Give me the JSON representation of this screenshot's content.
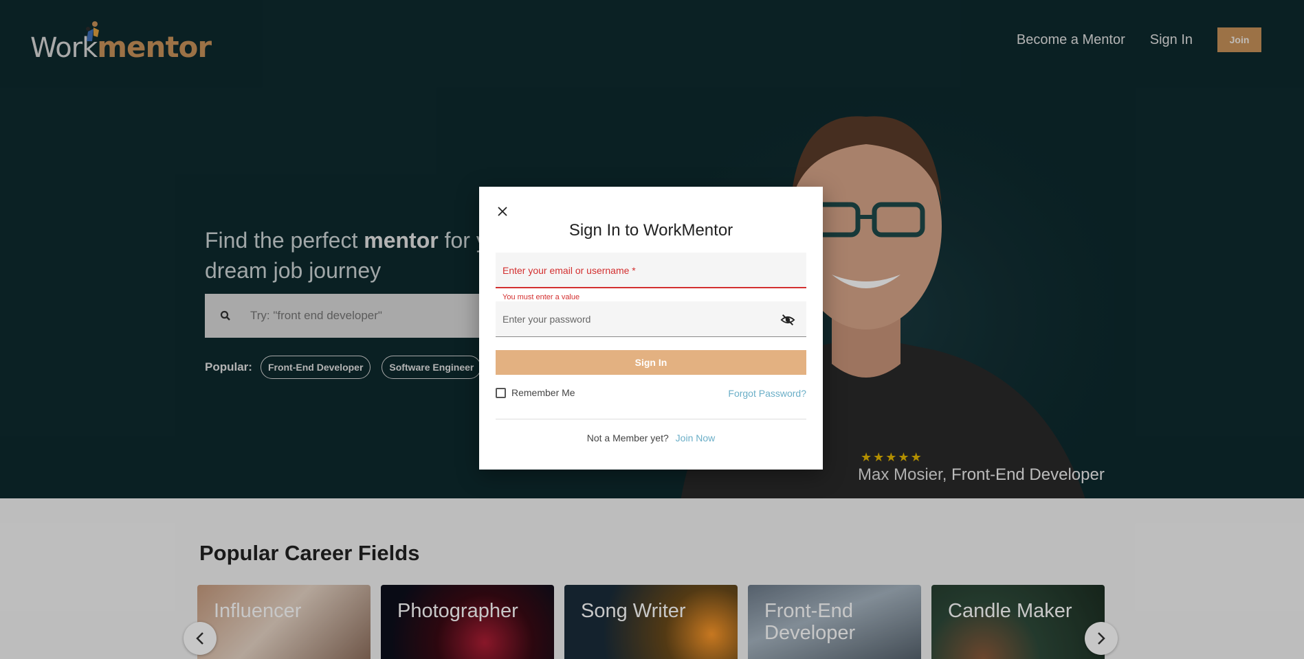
{
  "header": {
    "logo_work": "Work",
    "logo_mentor": "mentor",
    "nav": {
      "become_mentor": "Become a Mentor",
      "sign_in": "Sign In",
      "join": "Join"
    }
  },
  "hero": {
    "headline_pre": "Find the perfect ",
    "headline_bold": "mentor",
    "headline_post": " for your dream job journey",
    "search_placeholder": "Try: \"front end developer\"",
    "popular_label": "Popular:",
    "popular_chips": [
      "Front-End Developer",
      "Software Engineer"
    ],
    "rating_stars": 5,
    "mentor_name": "Max Mosier,",
    "mentor_role": "Front-End Developer"
  },
  "section": {
    "title": "Popular Career Fields",
    "cards": [
      "Influencer",
      "Photographer",
      "Song Writer",
      "Front-End Developer",
      "Candle Maker"
    ]
  },
  "modal": {
    "title": "Sign In to WorkMentor",
    "email_placeholder": "Enter your email or username *",
    "email_error": "You must enter a value",
    "password_placeholder": "Enter your password",
    "signin_label": "Sign In",
    "remember_label": "Remember Me",
    "forgot_label": "Forgot Password?",
    "not_member": "Not a Member yet?",
    "join_now": "Join Now"
  },
  "colors": {
    "hero_bg": "#0e2a2e",
    "brand_accent": "#c8925a",
    "button_accent": "#e3b181",
    "error": "#d32f2f",
    "link": "#6aaec7"
  }
}
